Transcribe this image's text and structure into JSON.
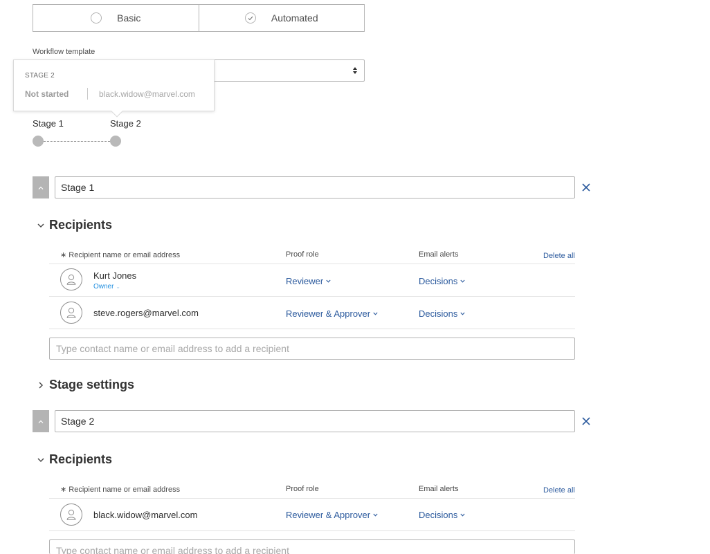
{
  "workflow_type": {
    "options": [
      {
        "label": "Basic",
        "selected": false
      },
      {
        "label": "Automated",
        "selected": true
      }
    ]
  },
  "workflow_template": {
    "label": "Workflow template",
    "value": ""
  },
  "tooltip": {
    "stage": "STAGE 2",
    "status": "Not started",
    "email": "black.widow@marvel.com"
  },
  "timeline": {
    "stages": [
      "Stage 1",
      "Stage 2"
    ]
  },
  "columns": {
    "recipient": "Recipient name or email address",
    "proof_role": "Proof role",
    "email_alerts": "Email alerts",
    "delete_all": "Delete all"
  },
  "stages": [
    {
      "name": "Stage 1",
      "recipients_title": "Recipients",
      "recipients": [
        {
          "name": "Kurt Jones",
          "role_badge": "Owner",
          "proof_role": "Reviewer",
          "email_alerts": "Decisions"
        },
        {
          "name": "steve.rogers@marvel.com",
          "role_badge": "",
          "proof_role": "Reviewer & Approver",
          "email_alerts": "Decisions"
        }
      ],
      "add_placeholder": "Type contact name or email address to add a recipient",
      "settings_title": "Stage settings"
    },
    {
      "name": "Stage 2",
      "recipients_title": "Recipients",
      "recipients": [
        {
          "name": "black.widow@marvel.com",
          "role_badge": "",
          "proof_role": "Reviewer & Approver",
          "email_alerts": "Decisions"
        }
      ],
      "add_placeholder": "Type contact name or email address to add a recipient"
    }
  ],
  "colors": {
    "link": "#2d5b9e",
    "owner": "#1f8ee0",
    "remove": "#2d5b9e",
    "collapse_button": "#b4b4b4",
    "timeline_dot": "#b9b9b9"
  }
}
